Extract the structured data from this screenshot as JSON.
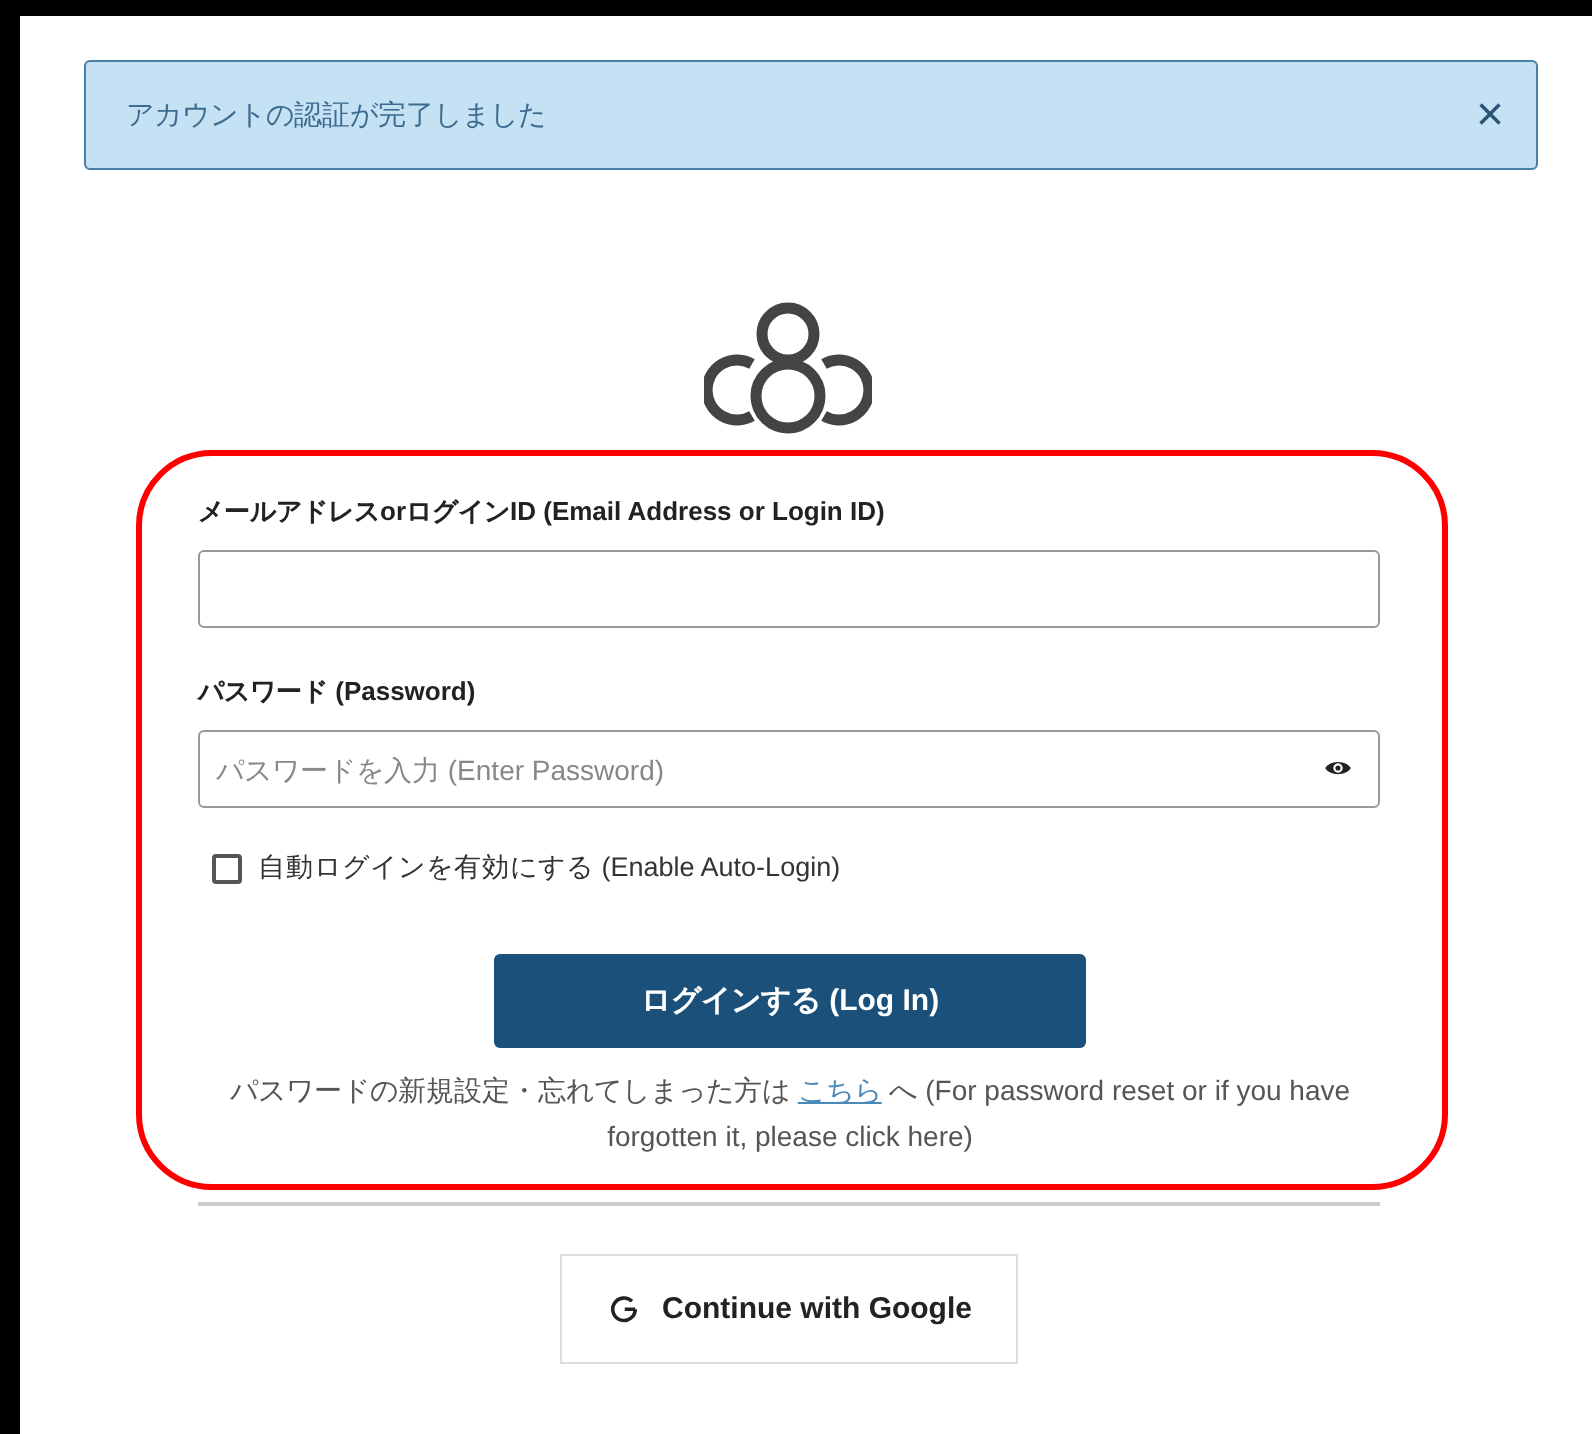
{
  "alert": {
    "message": "アカウントの認証が完了しました",
    "close": "×"
  },
  "form": {
    "email": {
      "label": "メールアドレスorログインID (Email Address or Login ID)"
    },
    "password": {
      "label": "パスワード (Password)",
      "placeholder": "パスワードを入力 (Enter Password)"
    },
    "auto_login": {
      "label": "自動ログインを有効にする (Enable Auto-Login)",
      "checked": false
    },
    "submit": "ログインする (Log In)",
    "reset": {
      "before": "パスワードの新規設定・忘れてしまった方は",
      "link": "こちら",
      "after": "へ (For password reset or if you have forgotten it, please click here)"
    }
  },
  "google_button": "Continue with Google"
}
